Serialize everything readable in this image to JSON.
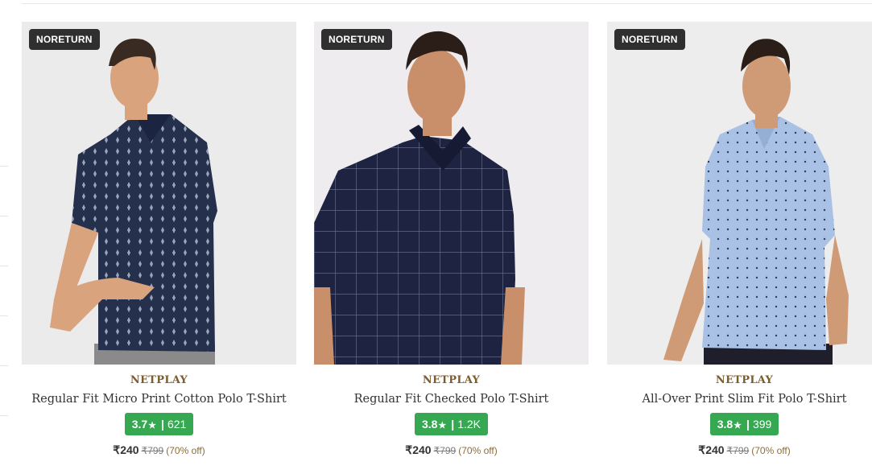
{
  "products": [
    {
      "badge": "NORETURN",
      "brand": "NETPLAY",
      "name": "Regular Fit Micro Print Cotton Polo T-Shirt",
      "rating": "3.7",
      "rating_count": "621",
      "price": "₹240",
      "mrp": "₹799",
      "discount": "(70% off)",
      "shirt_color": "#25304d",
      "pattern": "micro-print"
    },
    {
      "badge": "NORETURN",
      "brand": "NETPLAY",
      "name": "Regular Fit Checked Polo T-Shirt",
      "rating": "3.8",
      "rating_count": "1.2K",
      "price": "₹240",
      "mrp": "₹799",
      "discount": "(70% off)",
      "shirt_color": "#1d2340",
      "pattern": "checked"
    },
    {
      "badge": "NORETURN",
      "brand": "NETPLAY",
      "name": "All-Over Print Slim Fit Polo T-Shirt",
      "rating": "3.8",
      "rating_count": "399",
      "price": "₹240",
      "mrp": "₹799",
      "discount": "(70% off)",
      "shirt_color": "#a9c1e4",
      "pattern": "dot-print"
    }
  ],
  "colors": {
    "brand_text": "#7c5d2b",
    "rating_bg": "#36a852",
    "badge_bg": "#2f2f2f"
  }
}
